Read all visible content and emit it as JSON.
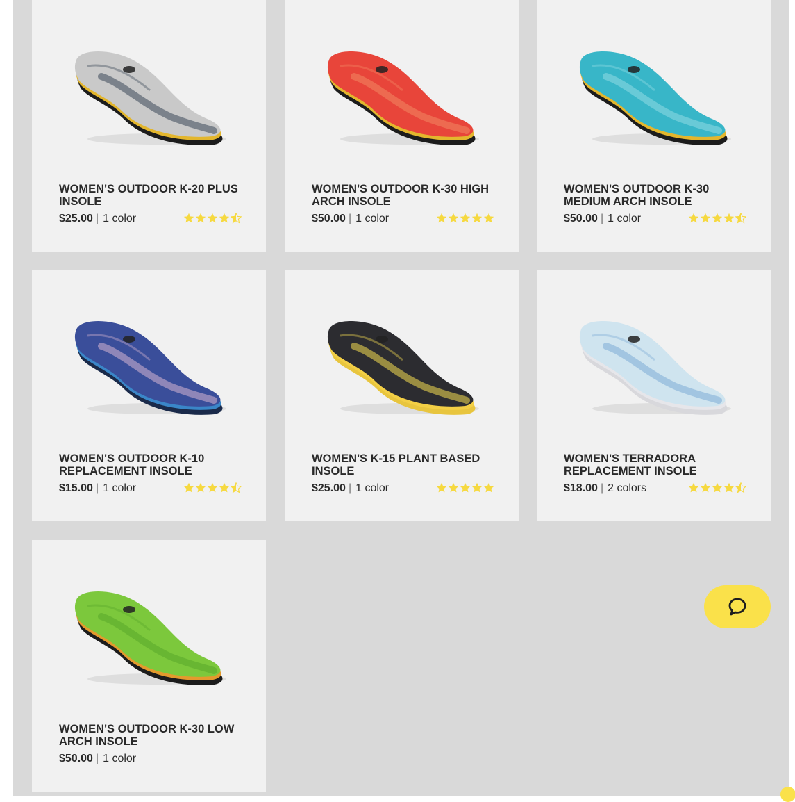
{
  "colors": {
    "page_background": "#d9d9d9",
    "card_background": "#f1f1f1",
    "star": "#f6d940",
    "chat_accent": "#fae14a"
  },
  "chat": {
    "icon": "chat-bubble-icon"
  },
  "products": [
    {
      "title": "WOMEN'S OUTDOOR K-20 PLUS INSOLE",
      "price": "$25.00",
      "colors": "1 color",
      "rating": 4.5,
      "insole": {
        "top": "#c9c9c9",
        "pattern": "#5a6470",
        "edge": "#e3b62d",
        "base": "#1c1c1c"
      }
    },
    {
      "title": "WOMEN'S OUTDOOR K-30 HIGH ARCH INSOLE",
      "price": "$50.00",
      "colors": "1 color",
      "rating": 5,
      "insole": {
        "top": "#e8453a",
        "pattern": "#f07a5a",
        "edge": "#e3b62d",
        "base": "#1c1c1c"
      }
    },
    {
      "title": "WOMEN'S OUTDOOR K-30 MEDIUM ARCH INSOLE",
      "price": "$50.00",
      "colors": "1 color",
      "rating": 4.5,
      "insole": {
        "top": "#38b6c8",
        "pattern": "#7fd3dd",
        "edge": "#e3b62d",
        "base": "#1c1c1c"
      }
    },
    {
      "title": "WOMEN'S OUTDOOR K-10 REPLACEMENT INSOLE",
      "price": "$15.00",
      "colors": "1 color",
      "rating": 4.5,
      "insole": {
        "top": "#3a4e9a",
        "pattern": "#b49ec4",
        "edge": "#3a86c8",
        "base": "#1a2a4a"
      }
    },
    {
      "title": "WOMEN'S K-15 PLANT BASED INSOLE",
      "price": "$25.00",
      "colors": "1 color",
      "rating": 5,
      "insole": {
        "top": "#2c2c30",
        "pattern": "#c9b64a",
        "edge": "#f3cf45",
        "base": "#e8c53e"
      }
    },
    {
      "title": "WOMEN'S TERRADORA REPLACEMENT INSOLE",
      "price": "$18.00",
      "colors": "2 colors",
      "rating": 4.5,
      "insole": {
        "top": "#cfe4ef",
        "pattern": "#8fb8dc",
        "edge": "#e6e6ea",
        "base": "#d8d8dc"
      }
    },
    {
      "title": "WOMEN'S OUTDOOR K-30 LOW ARCH INSOLE",
      "price": "$50.00",
      "colors": "1 color",
      "rating": null,
      "insole": {
        "top": "#7cc83c",
        "pattern": "#5fae2e",
        "edge": "#e39a2d",
        "base": "#1c1c1c"
      }
    }
  ]
}
